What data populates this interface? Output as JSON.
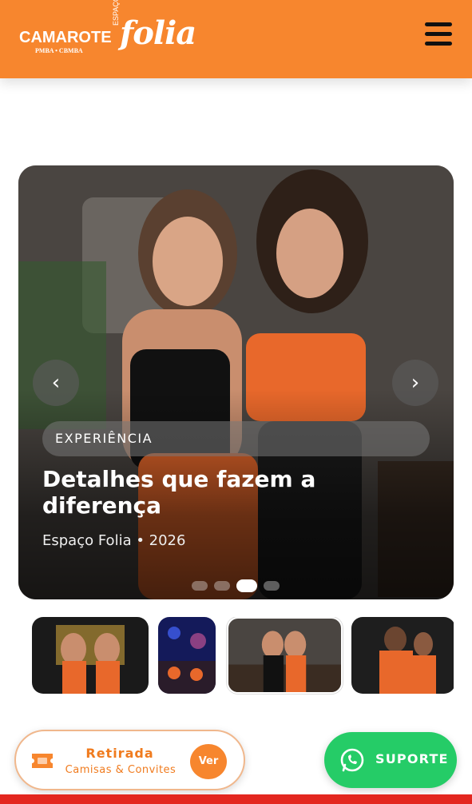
{
  "header": {
    "logo_camarote": "CAMAROTE",
    "logo_sub": "PMBA • CBMBA",
    "logo_espaco": "ESPAÇO",
    "logo_folia": "folia",
    "menu_icon": "hamburger-menu-icon",
    "brand_color": "#f7862e"
  },
  "hero": {
    "badge": "EXPERIÊNCIA",
    "title": "Detalhes que fazem a diferença",
    "meta": "Espaço Folia • 2026",
    "prev_icon": "chevron-left-icon",
    "next_icon": "chevron-right-icon",
    "prev_symbol": "‹",
    "next_symbol": "›",
    "slide_count": 4,
    "active_slide": 3
  },
  "thumbnails": [
    {
      "label": "thumb-1",
      "selected": false
    },
    {
      "label": "thumb-2",
      "selected": false
    },
    {
      "label": "thumb-3",
      "selected": true
    },
    {
      "label": "thumb-4",
      "selected": false
    }
  ],
  "retirada": {
    "title": "Retirada",
    "subtitle": "Camisas & Convites",
    "button": "Ver",
    "icon": "ticket-icon"
  },
  "suporte": {
    "label": "SUPORTE",
    "icon": "whatsapp-icon",
    "color": "#25cc67"
  }
}
